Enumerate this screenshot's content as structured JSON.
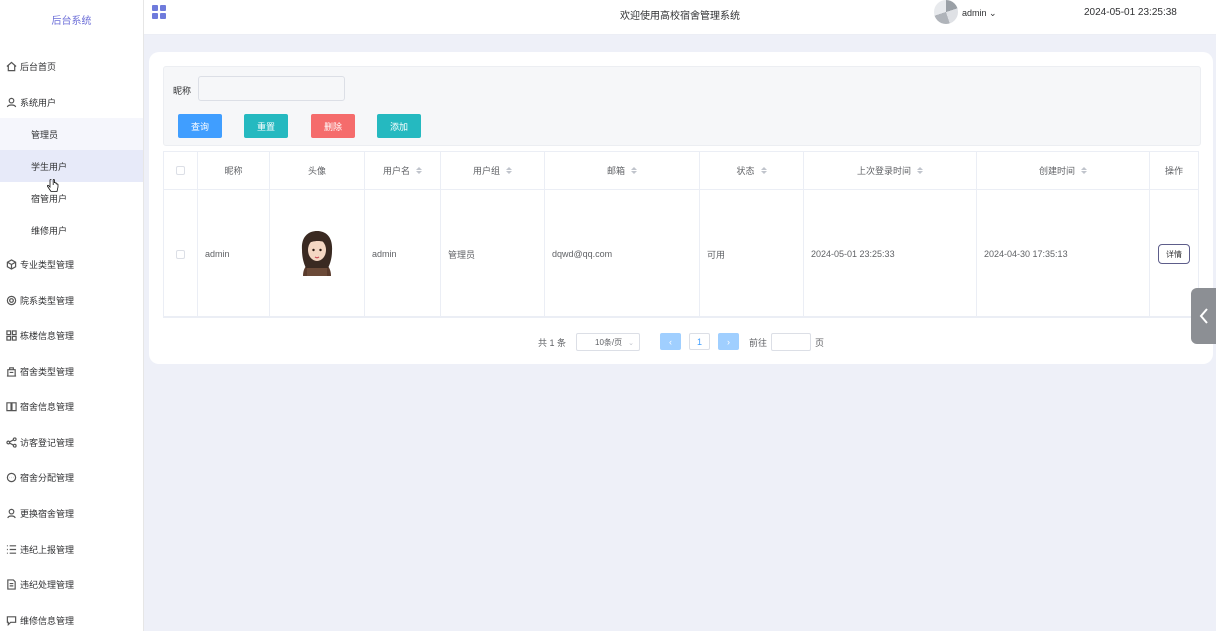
{
  "sidebar": {
    "title": "后台系统",
    "items": [
      {
        "label": "后台首页",
        "icon": "home-icon"
      },
      {
        "label": "系统用户",
        "icon": "user-icon"
      },
      {
        "label": "管理员"
      },
      {
        "label": "学生用户"
      },
      {
        "label": "宿管用户"
      },
      {
        "label": "维修用户"
      },
      {
        "label": "专业类型管理",
        "icon": "cube-icon"
      },
      {
        "label": "院系类型管理",
        "icon": "settings-icon"
      },
      {
        "label": "栋楼信息管理",
        "icon": "grid-icon"
      },
      {
        "label": "宿舍类型管理",
        "icon": "building-icon"
      },
      {
        "label": "宿舍信息管理",
        "icon": "book-icon"
      },
      {
        "label": "访客登记管理",
        "icon": "share-icon"
      },
      {
        "label": "宿舍分配管理",
        "icon": "chat-icon"
      },
      {
        "label": "更换宿舍管理",
        "icon": "person-icon"
      },
      {
        "label": "违纪上报管理",
        "icon": "list-icon"
      },
      {
        "label": "违纪处理管理",
        "icon": "document-icon"
      },
      {
        "label": "维修信息管理",
        "icon": "comment-icon"
      }
    ]
  },
  "header": {
    "welcome": "欢迎使用高校宿舍管理系统",
    "user": "admin",
    "datetime": "2024-05-01 23:25:38"
  },
  "search": {
    "nick_label": "昵称",
    "nick_value": ""
  },
  "actions": {
    "query": "查询",
    "reset": "重置",
    "delete": "删除",
    "add": "添加"
  },
  "table": {
    "columns": [
      "昵称",
      "头像",
      "用户名",
      "用户组",
      "邮箱",
      "状态",
      "上次登录时间",
      "创建时间",
      "操作"
    ],
    "rows": [
      {
        "nickname": "admin",
        "username": "admin",
        "group": "管理员",
        "email": "dqwd@qq.com",
        "status": "可用",
        "last_login": "2024-05-01 23:25:33",
        "created": "2024-04-30 17:35:13",
        "action": "详情"
      }
    ]
  },
  "pagination": {
    "total": "共 1 条",
    "page_size": "10条/页",
    "current_page": "1",
    "goto_label": "前往",
    "goto_unit": "页"
  }
}
